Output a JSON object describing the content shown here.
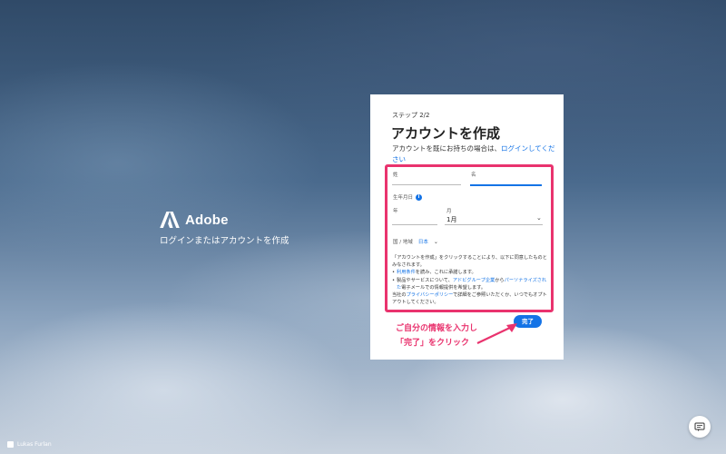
{
  "brand": {
    "name": "Adobe",
    "tagline": "ログインまたはアカウントを作成"
  },
  "form": {
    "step": "ステップ 2/2",
    "title": "アカウントを作成",
    "login_prefix": "アカウントを既にお持ちの場合は、",
    "login_link": "ログインしてください",
    "last_name_label": "姓",
    "first_name_label": "名",
    "last_name_value": "",
    "first_name_value": "",
    "dob_label": "生年月日",
    "year_label": "年",
    "month_label": "月",
    "month_value": "1月",
    "country_label": "国 / 地域",
    "country_value": "日本",
    "legal_line1": "「アカウントを作成」をクリックすることにより、以下に同意したものとみなされます。",
    "bullet1_link": "利用条件",
    "bullet1_rest": "を読み、これに承諾します。",
    "bullet2_pre": "製品やサービスについて、",
    "bullet2_link1": "アドビグループ企業",
    "bullet2_mid": "から",
    "bullet2_link2": "パーソナライズされた",
    "bullet2_rest": "電子メールでの情報提供を希望します。",
    "privacy_pre": "当社の",
    "privacy_link": "プライバシーポリシー",
    "privacy_rest": "で詳細をご参照いただくか、いつでもオプトアウトしてください。",
    "done_label": "完了"
  },
  "annotation": {
    "line1": "ご自分の情報を入力し",
    "line2": "「完了」をクリック"
  },
  "footer": {
    "credit": "Lukas Furlan"
  },
  "colors": {
    "accent": "#1473e6",
    "highlight": "#e9336e"
  },
  "icons": {
    "info": "info-icon",
    "chevron": "chevron-down-icon",
    "chat": "chat-icon"
  }
}
